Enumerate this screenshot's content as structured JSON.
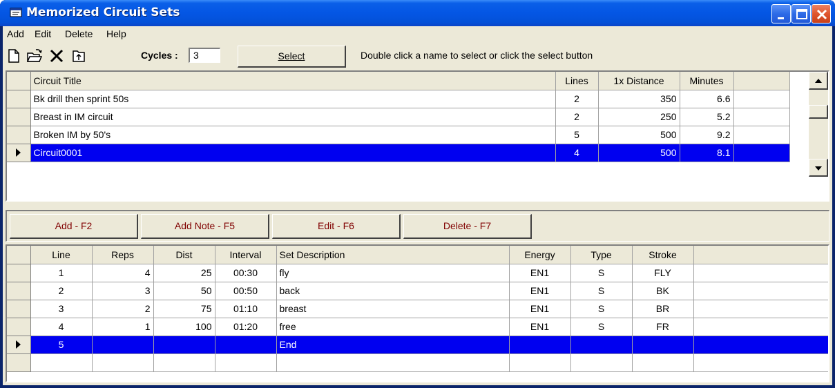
{
  "window": {
    "title": "Memorized Circuit Sets"
  },
  "menu": [
    "Add",
    "Edit",
    "Delete",
    "Help"
  ],
  "toolbar": {
    "icons": [
      "new-file-icon",
      "open-folder-icon",
      "delete-x-icon",
      "export-icon"
    ],
    "cycles_label": "Cycles :",
    "cycles_value": "3",
    "select_label": "Select",
    "hint": "Double click a name to select or click the select button"
  },
  "circuits": {
    "headers": [
      "Circuit Title",
      "Lines",
      "1x Distance",
      "Minutes"
    ],
    "rows": [
      {
        "title": "Bk drill then sprint 50s",
        "lines": "2",
        "distance": "350",
        "minutes": "6.6"
      },
      {
        "title": "Breast in IM circuit",
        "lines": "2",
        "distance": "250",
        "minutes": "5.2"
      },
      {
        "title": "Broken IM by 50's",
        "lines": "5",
        "distance": "500",
        "minutes": "9.2"
      },
      {
        "title": "Circuit0001",
        "lines": "4",
        "distance": "500",
        "minutes": "8.1"
      }
    ]
  },
  "actions": [
    "Add - F2",
    "Add Note - F5",
    "Edit - F6",
    "Delete - F7"
  ],
  "sets": {
    "headers": [
      "Line",
      "Reps",
      "Dist",
      "Interval",
      "Set Description",
      "Energy",
      "Type",
      "Stroke"
    ],
    "rows": [
      {
        "line": "1",
        "reps": "4",
        "dist": "25",
        "interval": "00:30",
        "desc": "fly",
        "energy": "EN1",
        "type": "S",
        "stroke": "FLY"
      },
      {
        "line": "2",
        "reps": "3",
        "dist": "50",
        "interval": "00:50",
        "desc": "back",
        "energy": "EN1",
        "type": "S",
        "stroke": "BK"
      },
      {
        "line": "3",
        "reps": "2",
        "dist": "75",
        "interval": "01:10",
        "desc": "breast",
        "energy": "EN1",
        "type": "S",
        "stroke": "BR"
      },
      {
        "line": "4",
        "reps": "1",
        "dist": "100",
        "interval": "01:20",
        "desc": "free",
        "energy": "EN1",
        "type": "S",
        "stroke": "FR"
      },
      {
        "line": "5",
        "reps": "",
        "dist": "",
        "interval": "",
        "desc": "End",
        "energy": "",
        "type": "",
        "stroke": ""
      }
    ]
  },
  "colors": {
    "selection": "#0000f0",
    "face": "#ece9d8",
    "titlebar": "#0456e4",
    "action_text": "#800000"
  }
}
